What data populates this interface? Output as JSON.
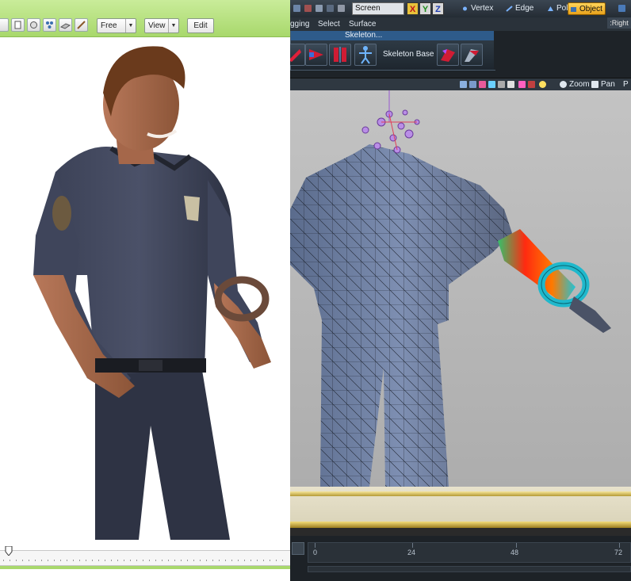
{
  "left_app": {
    "toolbar": {
      "camera_mode": "Free",
      "view_menu": "View",
      "edit_button": "Edit"
    },
    "colors": {
      "toolbar": "#b6e07c",
      "accent": "#a8d86c"
    }
  },
  "right_app": {
    "toolbar": {
      "coordinate_space": "Screen",
      "axis_x": "X",
      "axis_y": "Y",
      "axis_z": "Z",
      "mode_vertex": "Vertex",
      "mode_edge": "Edge",
      "mode_polygon": "Polygon",
      "mode_object": "Object"
    },
    "tabs": [
      "gging",
      "Select",
      "Surface"
    ],
    "view_label": ":Right",
    "skeleton_panel": {
      "title": "Skeleton...",
      "base_label": "Skeleton Base"
    },
    "viewport_toolbar": {
      "zoom": "Zoom",
      "pan": "Pan",
      "extra": "P"
    },
    "timeline": {
      "ticks": [
        "0",
        "24",
        "48",
        "72"
      ]
    },
    "colors": {
      "object_mode": "#f0b83a",
      "viewport": "#b8b8b8",
      "panel_header": "#2e5b8a"
    }
  }
}
